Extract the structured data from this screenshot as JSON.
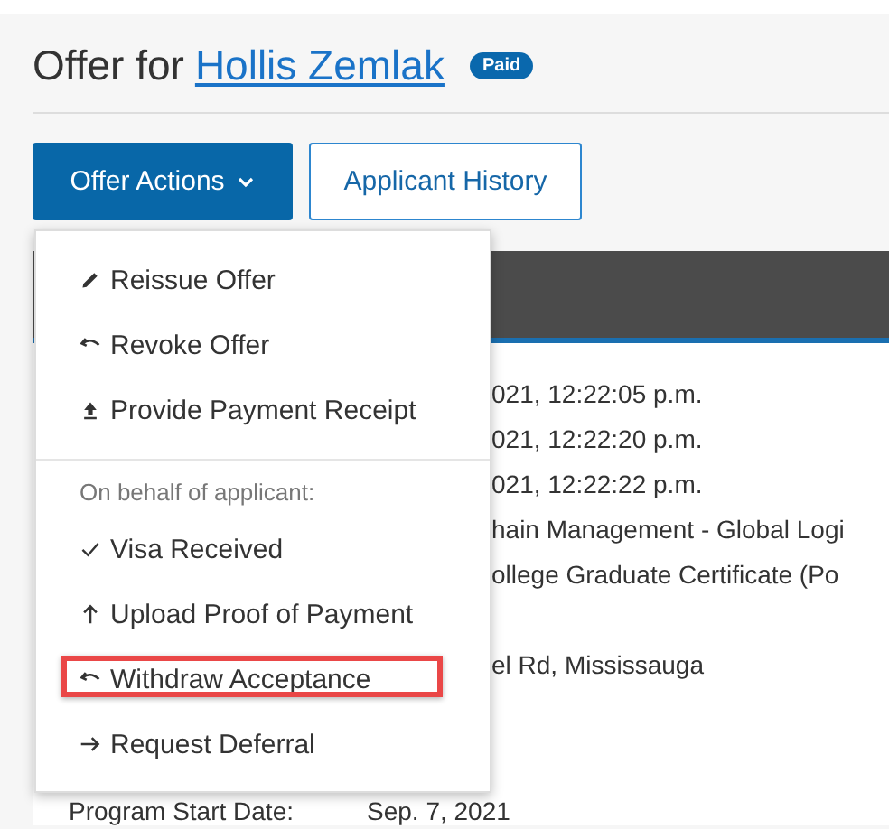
{
  "page": {
    "title_prefix": "Offer for",
    "applicant_name": "Hollis Zemlak",
    "badge": "Paid"
  },
  "buttons": [
    {
      "label": "Offer Actions",
      "kind": "dropdown"
    },
    {
      "label": "Applicant History",
      "kind": "outline"
    }
  ],
  "menu": {
    "items": [
      {
        "kind": "pencil",
        "label": "Reissue Offer",
        "highlighted": false
      },
      {
        "kind": "undo",
        "label": "Revoke Offer",
        "highlighted": false
      },
      {
        "kind": "upload",
        "label": "Provide Payment Receipt",
        "highlighted": false
      },
      {
        "kind": "divider"
      },
      {
        "kind": "header",
        "label": "On behalf of applicant:"
      },
      {
        "kind": "check",
        "label": "Visa Received",
        "highlighted": false
      },
      {
        "kind": "up",
        "label": "Upload Proof of Payment",
        "highlighted": false
      },
      {
        "kind": "undo",
        "label": "Withdraw Acceptance",
        "highlighted": true
      },
      {
        "kind": "right",
        "label": "Request Deferral",
        "highlighted": false
      }
    ]
  },
  "details": {
    "rows": [
      {
        "value": "021, 12:22:05 p.m."
      },
      {
        "value": "021, 12:22:20 p.m."
      },
      {
        "value": "021, 12:22:22 p.m."
      },
      {
        "value": "hain Management - Global Logi"
      },
      {
        "value": "ollege Graduate Certificate (Po"
      },
      {
        "value": "el Rd, Mississauga"
      }
    ],
    "last_row": {
      "label": "Program Start Date:",
      "value": "Sep. 7, 2021"
    }
  }
}
